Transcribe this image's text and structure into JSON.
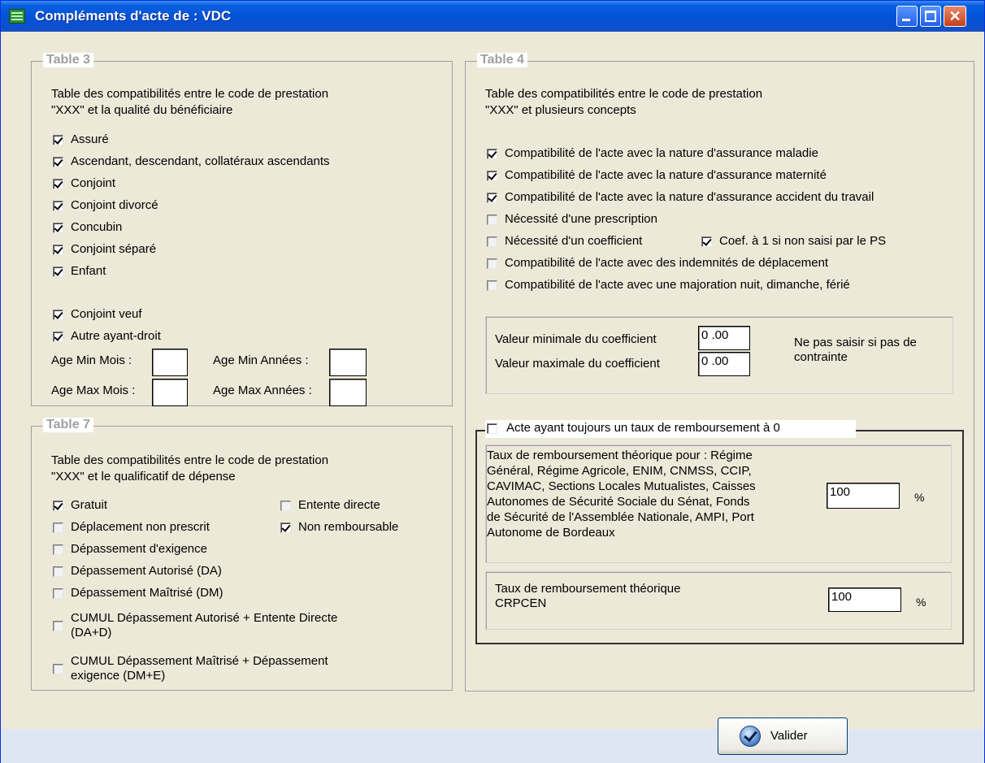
{
  "window": {
    "title": "Compléments d'acte de : VDC"
  },
  "table3": {
    "legend": "Table 3",
    "desc1": "Table des compatibilités entre le code de prestation",
    "desc2": "\"XXX\" et la qualité du bénéficiaire",
    "items": [
      {
        "label": "Assuré",
        "checked": true
      },
      {
        "label": "Ascendant, descendant, collatéraux ascendants",
        "checked": true
      },
      {
        "label": "Conjoint",
        "checked": true
      },
      {
        "label": "Conjoint divorcé",
        "checked": true
      },
      {
        "label": "Concubin",
        "checked": true
      },
      {
        "label": "Conjoint séparé",
        "checked": true
      },
      {
        "label": "Enfant",
        "checked": true
      },
      {
        "label": "Conjoint veuf",
        "checked": true
      },
      {
        "label": "Autre ayant-droit",
        "checked": true
      }
    ],
    "age_min_mois": "Age Min Mois :",
    "age_min_annees": "Age Min Années :",
    "age_max_mois": "Age Max Mois :",
    "age_max_annees": "Age Max Années :"
  },
  "table7": {
    "legend": "Table 7",
    "desc1": "Table des compatibilités entre le code de prestation",
    "desc2": "\"XXX\" et le qualificatif de dépense",
    "items": [
      {
        "label": "Gratuit",
        "checked": true
      },
      {
        "label": "Entente directe",
        "checked": false
      },
      {
        "label": "Déplacement non prescrit",
        "checked": false
      },
      {
        "label": "Non remboursable",
        "checked": true
      },
      {
        "label": "Dépassement d'exigence",
        "checked": false
      },
      {
        "label": "Dépassement Autorisé (DA)",
        "checked": false
      },
      {
        "label": "Dépassement Maîtrisé (DM)",
        "checked": false
      },
      {
        "label": "CUMUL Dépassement Autorisé + Entente Directe",
        "label2": "(DA+D)",
        "checked": false
      },
      {
        "label": "CUMUL Dépassement Maîtrisé + Dépassement",
        "label2": "exigence (DM+E)",
        "checked": false
      }
    ]
  },
  "table4": {
    "legend": "Table 4",
    "desc1": "Table des compatibilités entre le code de prestation",
    "desc2": "\"XXX\" et plusieurs concepts",
    "items": [
      {
        "label": "Compatibilité de l'acte avec la nature d'assurance maladie",
        "checked": true
      },
      {
        "label": "Compatibilité de l'acte avec la nature d'assurance maternité",
        "checked": true
      },
      {
        "label": "Compatibilité de l'acte avec la nature d'assurance accident du travail",
        "checked": true
      },
      {
        "label": "Nécessité d'une prescription",
        "checked": false
      },
      {
        "label": "Nécessité d'un coefficient",
        "checked": false
      },
      {
        "label": "Coef. à 1 si non saisi par le PS",
        "checked": true
      },
      {
        "label": "Compatibilité de l'acte avec des indemnités de déplacement",
        "checked": false
      },
      {
        "label": "Compatibilité de l'acte avec une majoration nuit, dimanche, férié",
        "checked": false
      }
    ],
    "coef_min_label": "Valeur minimale du coefficient",
    "coef_min_value": "0  .00",
    "coef_max_label": "Valeur maximale du coefficient",
    "coef_max_value": "0  .00",
    "note1": "Ne pas saisir si pas de",
    "note2": "contrainte"
  },
  "taux": {
    "checkbox_label": "Acte ayant toujours un taux de remboursement à 0",
    "checked": false,
    "general_lines": [
      "Taux de remboursement théorique pour : Régime",
      "Général, Régime Agricole, ENIM, CNMSS, CCIP,",
      "CAVIMAC, Sections Locales Mutualistes, Caisses",
      "Autonomes de Sécurité Sociale du Sénat, Fonds",
      "de Sécurité de l'Assemblée Nationale, AMPI, Port",
      "Autonome de Bordeaux"
    ],
    "general_value": "100",
    "crpcen_line1": "Taux de remboursement théorique",
    "crpcen_line2": "CRPCEN",
    "crpcen_value": "100",
    "pct": "%"
  },
  "footer": {
    "valider_label": "Valider"
  }
}
